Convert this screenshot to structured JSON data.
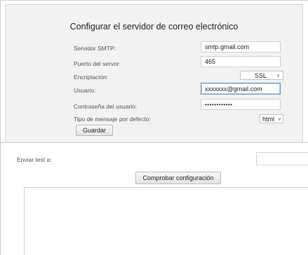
{
  "title": "Configurar el servidor de correo electrónico",
  "form": {
    "smtp_label": "Servidor SMTP:",
    "smtp_value": "smtp.gmail.com",
    "port_label": "Puerto del servor:",
    "port_value": "465",
    "encryption_label": "Encriptación:",
    "encryption_value": "SSL",
    "user_label": "Usuario:",
    "user_value": "xxxxxxx@gmail.com",
    "password_label": "Contraseña del usuario:",
    "password_value": "••••••••••••",
    "message_type_label": "Tipo de mensaje por defecto:",
    "message_type_value": "html",
    "save_label": "Guardar"
  },
  "test": {
    "send_label": "Enviar test a:",
    "send_value": "",
    "check_label": "Comprobar configuración",
    "output_text": ""
  }
}
